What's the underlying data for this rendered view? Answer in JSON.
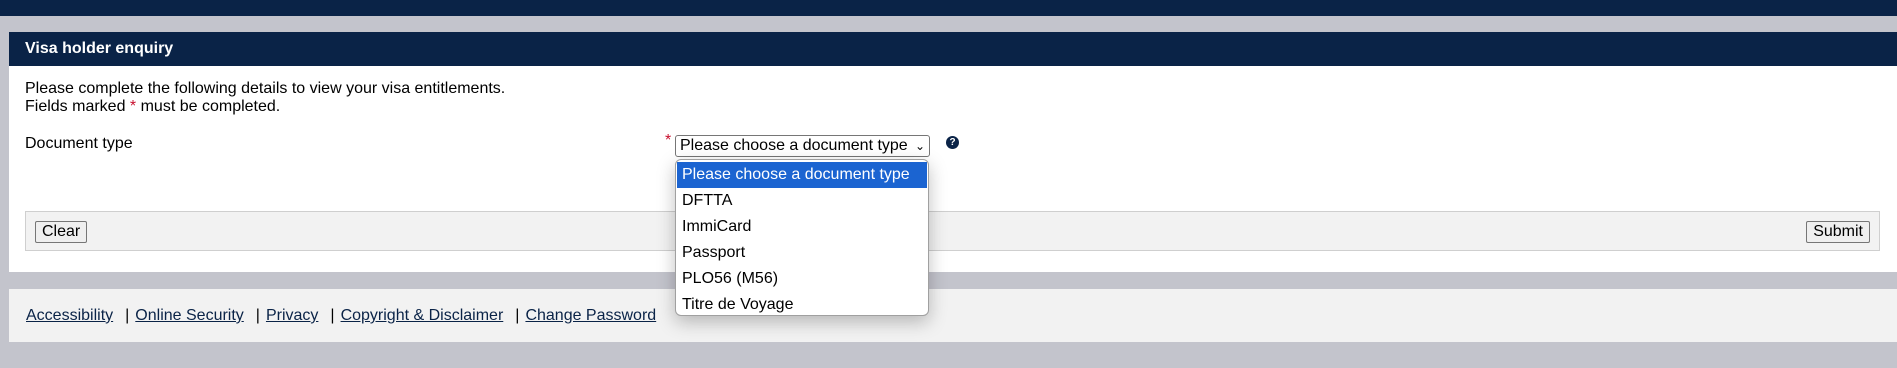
{
  "panel": {
    "title": "Visa holder enquiry",
    "intro_line1": "Please complete the following details to view your visa entitlements.",
    "intro_line2_prefix": "Fields marked ",
    "required_marker": "*",
    "intro_line2_suffix": " must be completed."
  },
  "form": {
    "document_type_label": "Document type",
    "required_marker": "*",
    "select_value": "Please choose a document type",
    "help_icon_glyph": "?",
    "options": [
      "Please choose a document type",
      "DFTTA",
      "ImmiCard",
      "Passport",
      "PLO56 (M56)",
      "Titre de Voyage"
    ],
    "selected_index": 0
  },
  "buttons": {
    "clear": "Clear",
    "submit": "Submit"
  },
  "footer": {
    "links": [
      "Accessibility",
      "Online Security",
      "Privacy",
      "Copyright & Disclaimer",
      "Change Password"
    ],
    "separator": "|"
  },
  "colors": {
    "navy": "#0a2347",
    "required_red": "#c8102e",
    "selected_blue": "#1b64d1"
  },
  "icons": {
    "help": "help-circle-icon",
    "select_arrow": "chevron-down-icon"
  }
}
